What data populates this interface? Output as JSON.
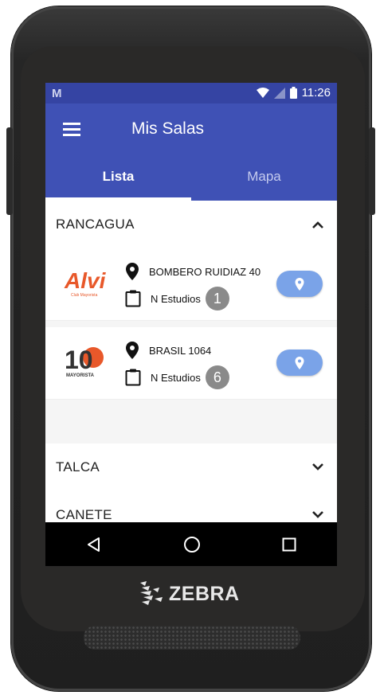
{
  "status_bar": {
    "time": "11:26"
  },
  "app_bar": {
    "title": "Mis Salas"
  },
  "tabs": [
    {
      "label": "Lista",
      "active": true
    },
    {
      "label": "Mapa",
      "active": false
    }
  ],
  "sections": [
    {
      "city": "RANCAGUA",
      "expanded": true,
      "stores": [
        {
          "brand_logo": "Alvi",
          "brand_tagline": "Club Mayorista",
          "address": "BOMBERO RUIDIAZ 40",
          "studies_label": "N Estudios",
          "studies_count": "1"
        },
        {
          "brand_logo": "10",
          "brand_tagline": "MAYORISTA",
          "address": "BRASIL 1064",
          "studies_label": "N Estudios",
          "studies_count": "6"
        }
      ]
    },
    {
      "city": "TALCA",
      "expanded": false
    },
    {
      "city": "CANETE",
      "expanded": false
    }
  ],
  "device_brand": "ZEBRA",
  "colors": {
    "primary": "#3f51b5",
    "status_bar": "#3544a3",
    "map_button": "#7aa3e8",
    "badge": "#8a8a8a"
  }
}
